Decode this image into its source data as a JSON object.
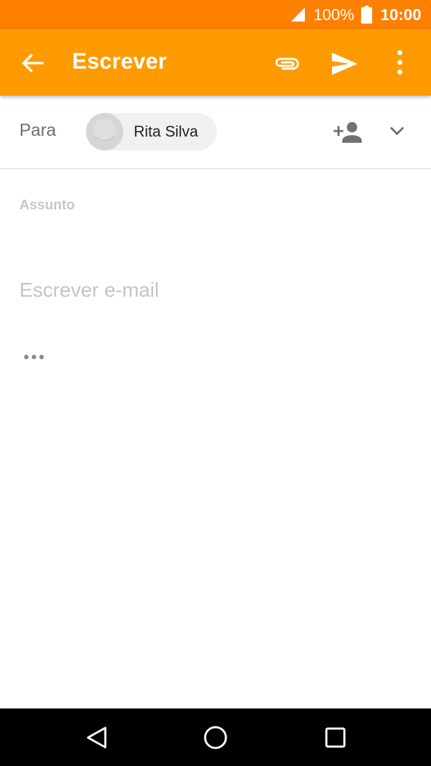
{
  "status_bar": {
    "battery_percent": "100%",
    "time": "10:00",
    "icons": [
      "signal-icon",
      "battery-icon"
    ]
  },
  "app_bar": {
    "title": "Escrever",
    "icons": [
      "back-arrow-icon",
      "paperclip-icon",
      "send-icon",
      "more-vert-icon"
    ]
  },
  "compose": {
    "to_label": "Para",
    "recipient_name": "Rita Silva",
    "subject_placeholder": "Assunto",
    "body_placeholder": "Escrever e-mail",
    "icons": [
      "avatar-icon",
      "add-person-icon",
      "chevron-down-icon",
      "more-horiz-icon"
    ]
  },
  "nav_bar": {
    "icons": [
      "nav-back-icon",
      "nav-home-icon",
      "nav-recents-icon"
    ]
  },
  "colors": {
    "status_bar": "#ff7f00",
    "app_bar": "#ff9a00",
    "chip": "#f1f1f1",
    "placeholder": "#c4c4c4"
  }
}
